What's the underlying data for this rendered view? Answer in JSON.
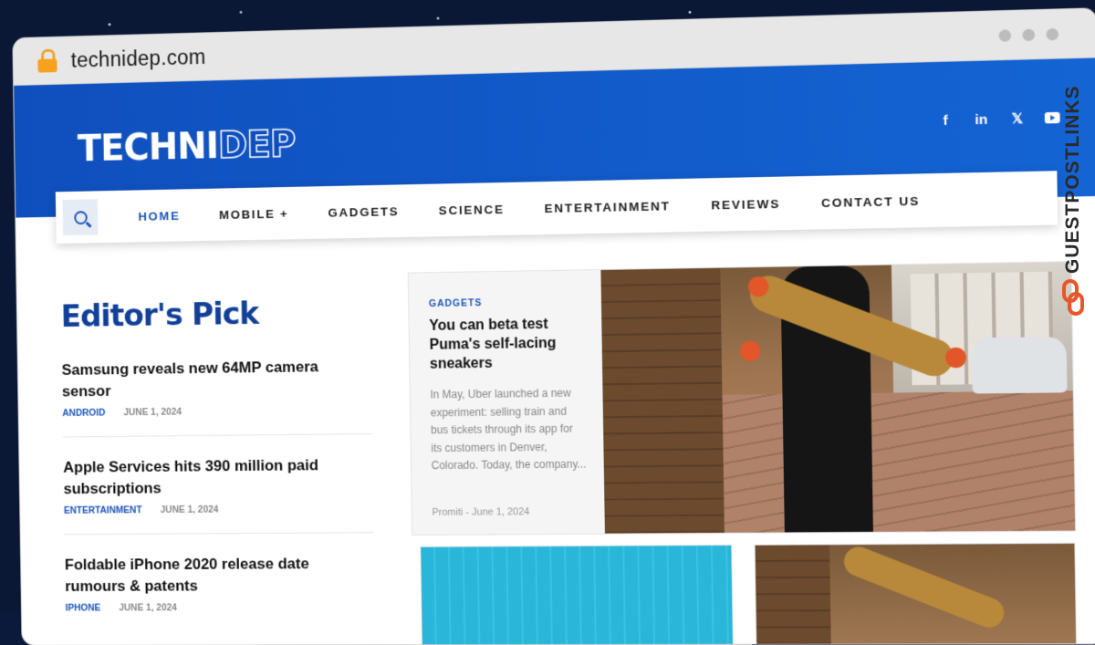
{
  "browser": {
    "url": "technidep.com"
  },
  "header": {
    "logo_part1": "TECHNI",
    "logo_part2": "DEP",
    "social": [
      "f",
      "in",
      "𝕏"
    ]
  },
  "nav": {
    "items": [
      "HOME",
      "MOBILE +",
      "GADGETS",
      "SCIENCE",
      "ENTERTAINMENT",
      "REVIEWS",
      "CONTACT US"
    ]
  },
  "editor": {
    "title": "Editor's Pick",
    "posts": [
      {
        "title": "Samsung reveals new 64MP camera sensor",
        "category": "ANDROID",
        "date": "JUNE 1, 2024"
      },
      {
        "title": "Apple Services hits 390 million paid subscriptions",
        "category": "ENTERTAINMENT",
        "date": "JUNE 1, 2024"
      },
      {
        "title": "Foldable iPhone 2020 release date rumours & patents",
        "category": "IPHONE",
        "date": "JUNE 1, 2024"
      }
    ]
  },
  "featured": {
    "category": "GADGETS",
    "title": "You can beta test Puma's self-lacing sneakers",
    "excerpt": "In May, Uber launched a new experiment: selling train and bus tickets through its app for its customers in Denver, Colorado. Today, the company...",
    "author": "Promiti",
    "separator": "-",
    "date": "June 1, 2024"
  },
  "watermark": {
    "text": "GUESTPOSTLINKS"
  },
  "colors": {
    "brand_blue": "#1461d3",
    "accent": "#1a55b8",
    "heading": "#123f97"
  }
}
